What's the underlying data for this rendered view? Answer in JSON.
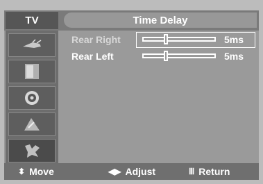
{
  "header": {
    "tab": "TV",
    "title": "Time Delay"
  },
  "sidebar": {
    "items": [
      {
        "name": "antenna-icon",
        "glyph": "⟿"
      },
      {
        "name": "picture-icon",
        "glyph": "▮"
      },
      {
        "name": "sound-icon",
        "glyph": "◉"
      },
      {
        "name": "channel-icon",
        "glyph": "▲"
      },
      {
        "name": "setup-icon",
        "glyph": "✦"
      }
    ]
  },
  "settings": [
    {
      "label": "Rear Right",
      "value": "5ms",
      "level": 0.3
    },
    {
      "label": "Rear Left",
      "value": "5ms",
      "level": 0.3
    }
  ],
  "footer": {
    "move": {
      "icon": "⬍",
      "label": "Move"
    },
    "adjust": {
      "icon": "◀▶",
      "label": "Adjust"
    },
    "return": {
      "icon": "Ⅲ",
      "label": "Return"
    }
  }
}
